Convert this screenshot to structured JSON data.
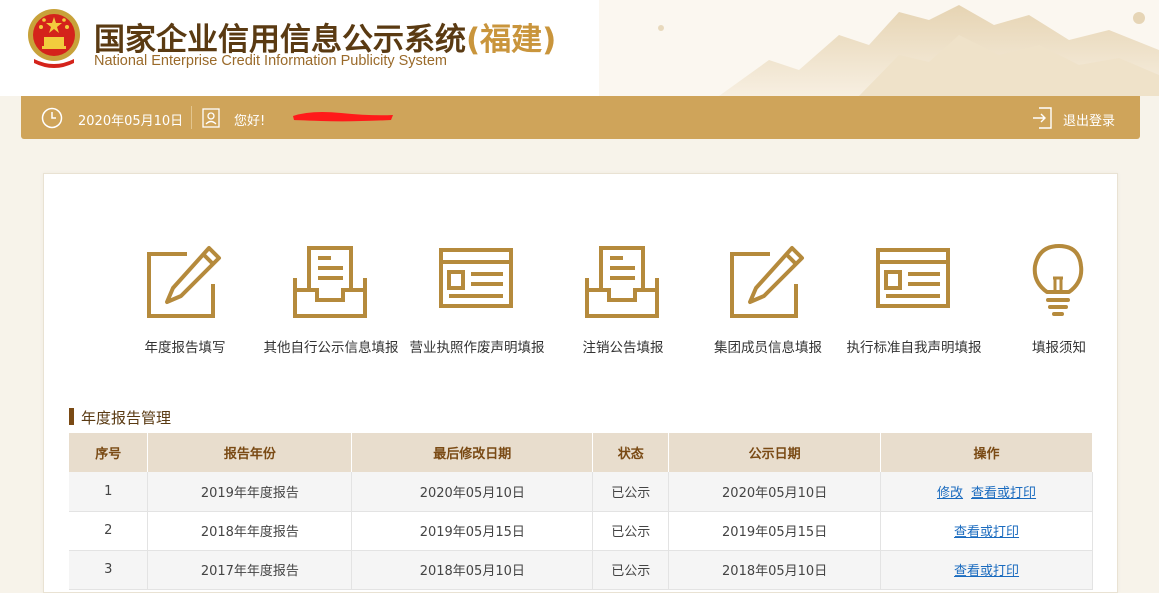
{
  "header": {
    "title_main": "国家企业信用信息公示系统",
    "title_province": "(福建)",
    "title_en": "National Enterprise Credit Information Publicity System"
  },
  "topbar": {
    "date": "2020年05月10日",
    "greeting": "您好!",
    "logout": "退出登录"
  },
  "functions": [
    {
      "label": "年度报告填写",
      "icon": "pen-edit-icon"
    },
    {
      "label": "其他自行公示信息填报",
      "icon": "inbox-document-icon"
    },
    {
      "label": "营业执照作废声明填报",
      "icon": "license-card-icon"
    },
    {
      "label": "注销公告填报",
      "icon": "inbox-document-icon"
    },
    {
      "label": "集团成员信息填报",
      "icon": "pen-edit-icon"
    },
    {
      "label": "执行标准自我声明填报",
      "icon": "license-card-icon"
    },
    {
      "label": "填报须知",
      "icon": "lightbulb-icon"
    }
  ],
  "section": {
    "title": "年度报告管理"
  },
  "table": {
    "headers": [
      "序号",
      "报告年份",
      "最后修改日期",
      "状态",
      "公示日期",
      "操作"
    ],
    "rows": [
      {
        "no": "1",
        "year": "2019年年度报告",
        "modified": "2020年05月10日",
        "status": "已公示",
        "published": "2020年05月10日",
        "actions": [
          "修改",
          "查看或打印"
        ]
      },
      {
        "no": "2",
        "year": "2018年年度报告",
        "modified": "2019年05月15日",
        "status": "已公示",
        "published": "2019年05月15日",
        "actions": [
          "查看或打印"
        ]
      },
      {
        "no": "3",
        "year": "2017年年度报告",
        "modified": "2018年05月10日",
        "status": "已公示",
        "published": "2018年05月10日",
        "actions": [
          "查看或打印"
        ]
      }
    ]
  },
  "colors": {
    "gold": "#cfa45a",
    "brown": "#7a4a14",
    "icon": "#b58a3c",
    "link": "#1a6bbf"
  }
}
